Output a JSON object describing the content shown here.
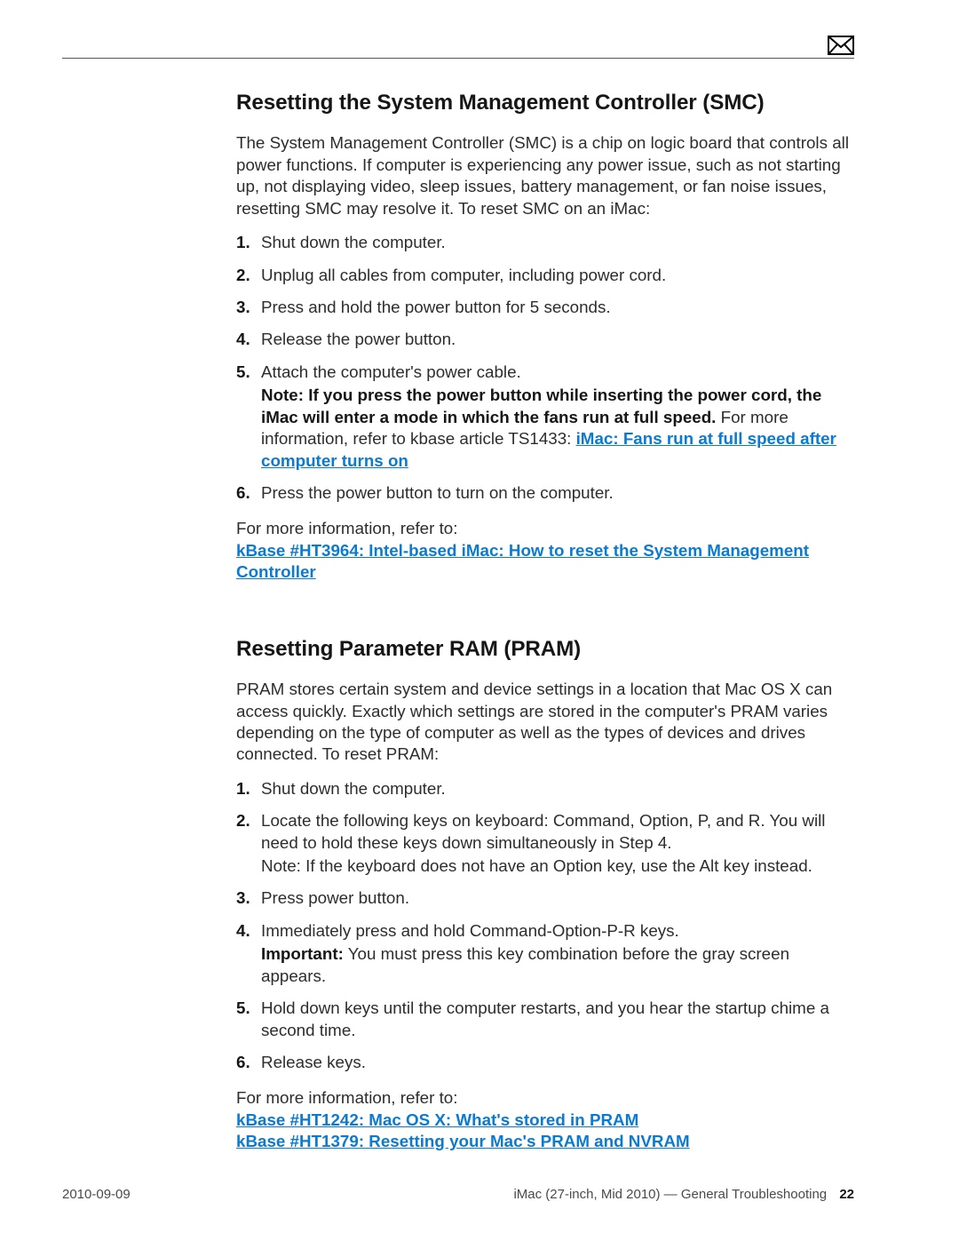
{
  "header": {
    "icon": "mail-icon"
  },
  "sections": {
    "smc": {
      "title": "Resetting the System Management Controller (SMC)",
      "intro": "The System Management Controller (SMC) is a chip on logic board that controls all power functions. If computer is experiencing any power issue, such as not starting up, not displaying video, sleep issues, battery management, or fan noise issues, resetting SMC may resolve it. To reset SMC on an iMac:",
      "steps": [
        "Shut down the computer.",
        "Unplug all cables from computer, including power cord.",
        "Press and hold the power button for 5 seconds.",
        "Release the power button.",
        "Attach the computer's power cable.",
        "Press the power button to turn on the computer."
      ],
      "step5_note_bold_label": "Note",
      "step5_note_bold_tail": ": If you press the power button while inserting the power cord, the iMac will enter a mode in which the fans run at full speed.",
      "step5_note_rest": " For more information, refer to kbase article TS1433: ",
      "step5_link_text": "iMac: Fans run at full speed after computer turns on",
      "more_info_label": "For more information, refer to:",
      "more_info_link": "kBase #HT3964: Intel-based iMac: How to reset the System Management Controller"
    },
    "pram": {
      "title": "Resetting Parameter RAM (PRAM)",
      "intro": "PRAM stores certain system and device settings in a location that Mac OS X can access quickly. Exactly which settings are stored in the computer's PRAM varies depending on the type of computer as well as the types of devices and drives connected. To reset PRAM:",
      "steps": [
        "Shut down the computer.",
        "Locate the following keys on keyboard: Command, Option, P, and R. You will need to hold these keys down simultaneously in Step 4.",
        "Press power button.",
        "Immediately press and hold Command-Option-P-R keys.",
        "Hold down keys until the computer restarts, and you hear the startup chime a second time.",
        "Release keys."
      ],
      "step2_note": "Note: If the keyboard does not have an Option key, use the Alt key instead.",
      "step4_important_label": "Important:",
      "step4_important_text": " You must press this key combination before the gray screen appears.",
      "more_info_label": "For more information, refer to:",
      "more_info_links": [
        "kBase #HT1242: Mac OS X: What's stored in PRAM",
        "kBase #HT1379: Resetting your Mac's PRAM and NVRAM"
      ]
    }
  },
  "footer": {
    "date": "2010-09-09",
    "doc_title": "iMac (27-inch, Mid 2010) — General Troubleshooting",
    "page_number": "22"
  }
}
